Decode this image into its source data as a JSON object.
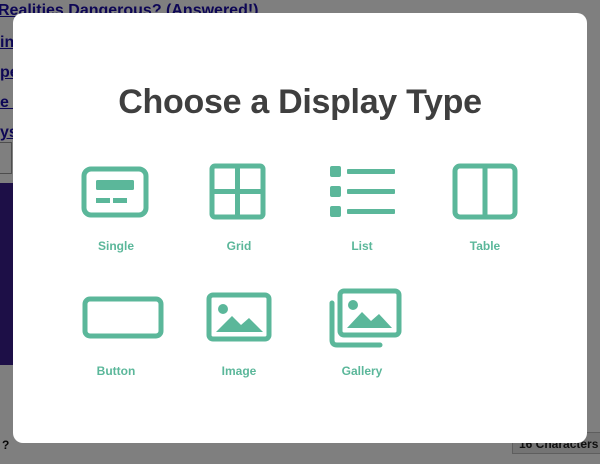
{
  "background": {
    "links": [
      "Realities Dangerous? (Answered!)",
      "ing",
      "pe",
      "e th",
      "ys"
    ],
    "footer_help": "?",
    "char_count": "16 Characters"
  },
  "modal": {
    "title": "Choose a Display Type",
    "accent_color": "#5bb79a",
    "options": [
      {
        "label": "Single",
        "icon": "single-card-icon"
      },
      {
        "label": "Grid",
        "icon": "grid-icon"
      },
      {
        "label": "List",
        "icon": "list-icon"
      },
      {
        "label": "Table",
        "icon": "table-columns-icon"
      },
      {
        "label": "Button",
        "icon": "button-icon"
      },
      {
        "label": "Image",
        "icon": "image-icon"
      },
      {
        "label": "Gallery",
        "icon": "gallery-icon"
      }
    ]
  }
}
